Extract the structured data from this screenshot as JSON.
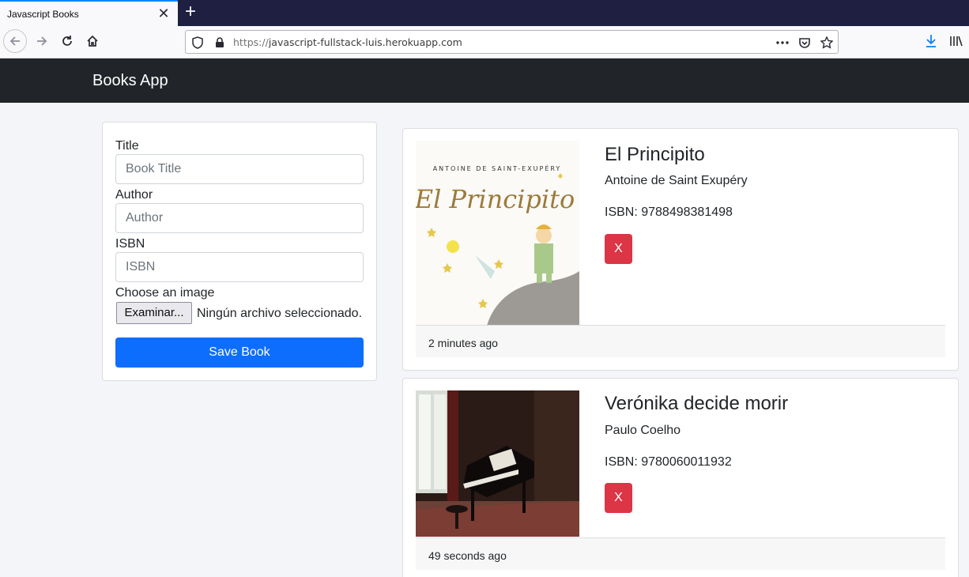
{
  "browser": {
    "tab_title": "Javascript Books",
    "url_scheme": "https://",
    "url_host": "javascript-fullstack-luis.herokuapp.com"
  },
  "app": {
    "brand": "Books App"
  },
  "form": {
    "title_label": "Title",
    "title_placeholder": "Book Title",
    "author_label": "Author",
    "author_placeholder": "Author",
    "isbn_label": "ISBN",
    "isbn_placeholder": "ISBN",
    "image_label": "Choose an image",
    "file_button": "Examinar...",
    "file_status": "Ningún archivo seleccionado.",
    "save_button": "Save Book"
  },
  "books": [
    {
      "title": "El Principito",
      "author": "Antoine de Saint Exupéry",
      "isbn": "ISBN: 9788498381498",
      "delete_label": "X",
      "time_ago": "2 minutes ago",
      "cover_author_text": "ANTOINE DE SAINT-EXUPÉRY",
      "cover_title_text": "El Principito"
    },
    {
      "title": "Verónika decide morir",
      "author": "Paulo Coelho",
      "isbn": "ISBN: 9780060011932",
      "delete_label": "X",
      "time_ago": "49 seconds ago"
    }
  ],
  "colors": {
    "primary": "#0d6efd",
    "danger": "#dc3545",
    "navbar": "#212529"
  }
}
